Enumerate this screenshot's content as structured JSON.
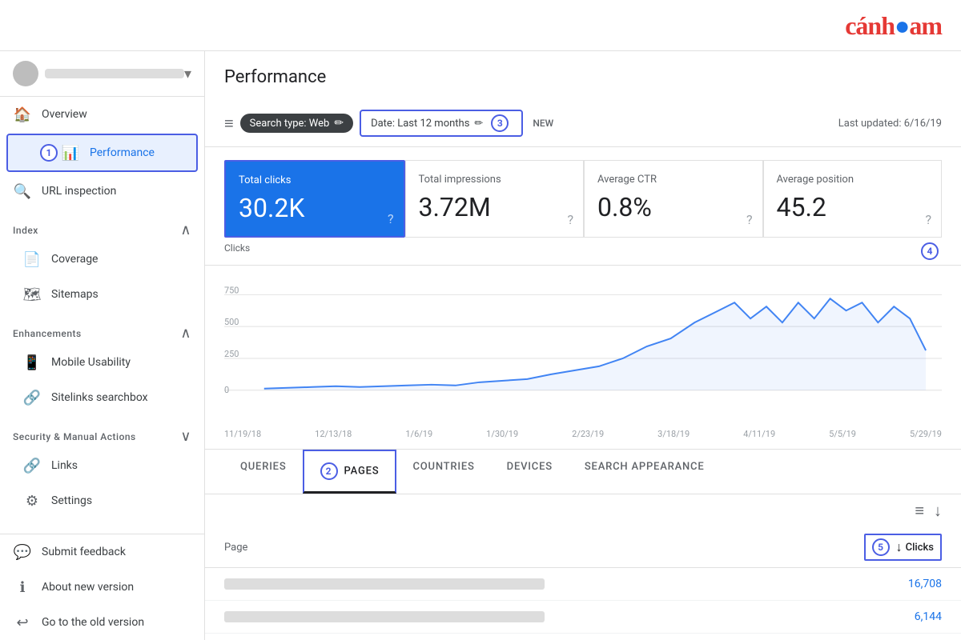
{
  "topbar": {
    "logo_text": "cánheam"
  },
  "sidebar": {
    "account_name": "account name placeholder",
    "items": [
      {
        "id": "overview",
        "label": "Overview",
        "icon": "🏠",
        "active": false
      },
      {
        "id": "performance",
        "label": "Performance",
        "icon": "📊",
        "active": true,
        "badge": "1"
      },
      {
        "id": "url-inspection",
        "label": "URL inspection",
        "icon": "🔍",
        "active": false
      }
    ],
    "sections": [
      {
        "id": "index",
        "label": "Index",
        "collapsed": false,
        "items": [
          {
            "id": "coverage",
            "label": "Coverage",
            "icon": "📄"
          },
          {
            "id": "sitemaps",
            "label": "Sitemaps",
            "icon": "🗺"
          }
        ]
      },
      {
        "id": "enhancements",
        "label": "Enhancements",
        "collapsed": false,
        "items": [
          {
            "id": "mobile-usability",
            "label": "Mobile Usability",
            "icon": "📱"
          },
          {
            "id": "sitelinks-searchbox",
            "label": "Sitelinks searchbox",
            "icon": "🔗"
          }
        ]
      },
      {
        "id": "security",
        "label": "Security & Manual Actions",
        "collapsed": false,
        "items": [
          {
            "id": "links",
            "label": "Links",
            "icon": "🔗"
          },
          {
            "id": "settings",
            "label": "Settings",
            "icon": "⚙"
          }
        ]
      }
    ],
    "bottom_items": [
      {
        "id": "submit-feedback",
        "label": "Submit feedback",
        "icon": "💬"
      },
      {
        "id": "about-version",
        "label": "About new version",
        "icon": "ℹ"
      },
      {
        "id": "old-version",
        "label": "Go to the old version",
        "icon": "↩"
      }
    ]
  },
  "performance": {
    "title": "Performance",
    "filters": {
      "filter_icon": "≡",
      "search_type_label": "Search type: Web",
      "date_label": "Date: Last 12 months",
      "new_label": "NEW",
      "badge_3": "3",
      "last_updated": "Last updated: 6/16/19"
    },
    "metrics": [
      {
        "id": "total-clicks",
        "label": "Total clicks",
        "value": "30.2K",
        "active": true
      },
      {
        "id": "total-impressions",
        "label": "Total impressions",
        "value": "3.72M",
        "active": false
      },
      {
        "id": "average-ctr",
        "label": "Average CTR",
        "value": "0.8%",
        "active": false
      },
      {
        "id": "average-position",
        "label": "Average position",
        "value": "45.2",
        "active": false
      }
    ],
    "chart": {
      "badge_4": "4",
      "clicks_label": "Clicks",
      "y_labels": [
        "750",
        "500",
        "250",
        "0"
      ],
      "x_labels": [
        "11/19/18",
        "12/13/18",
        "1/6/19",
        "1/30/19",
        "2/23/19",
        "3/18/19",
        "4/11/19",
        "5/5/19",
        "5/29/19"
      ]
    },
    "tabs": [
      {
        "id": "queries",
        "label": "QUERIES",
        "active": false
      },
      {
        "id": "pages",
        "label": "PAGES",
        "active": true,
        "badge": "2"
      },
      {
        "id": "countries",
        "label": "COUNTRIES",
        "active": false
      },
      {
        "id": "devices",
        "label": "DEVICES",
        "active": false
      },
      {
        "id": "search-appearance",
        "label": "SEARCH APPEARANCE",
        "active": false
      }
    ],
    "table": {
      "badge_5": "5",
      "col_page": "Page",
      "col_clicks": "Clicks",
      "rows": [
        {
          "id": "row-1",
          "page": "blurred url 1",
          "clicks": "16,708"
        },
        {
          "id": "row-2",
          "page": "blurred url 2",
          "clicks": "6,144"
        }
      ]
    }
  }
}
